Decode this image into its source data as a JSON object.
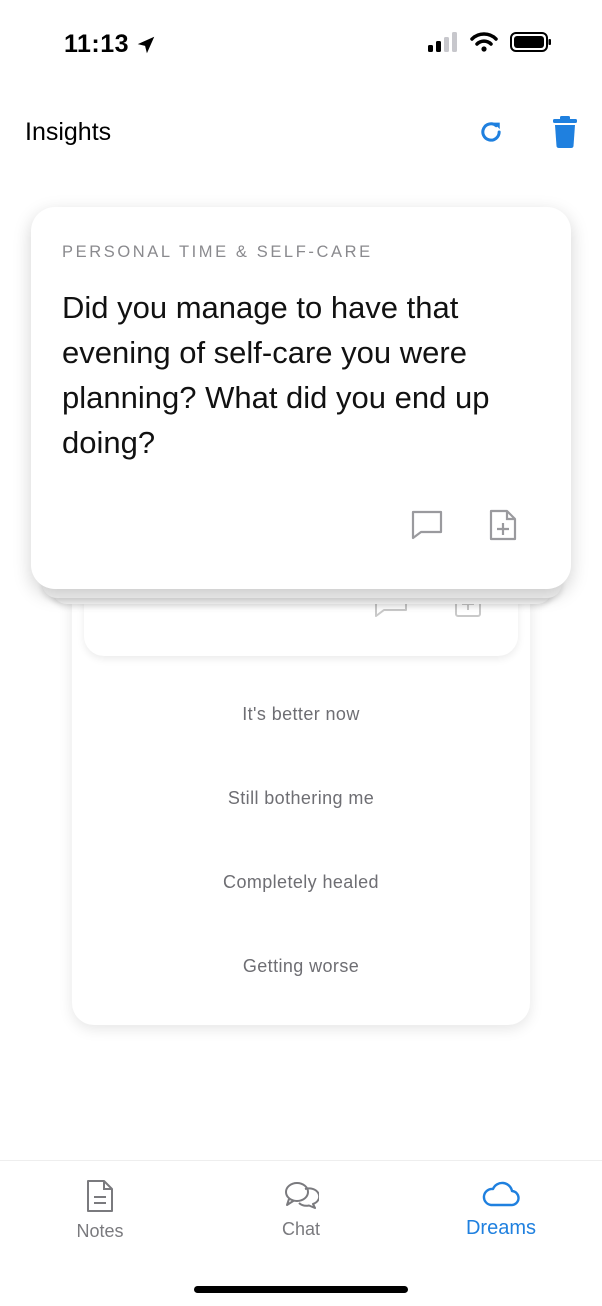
{
  "status_bar": {
    "time": "11:13",
    "icons": [
      "location-arrow-icon",
      "signal-icon",
      "wifi-icon",
      "battery-icon"
    ]
  },
  "header": {
    "title": "Insights",
    "refresh_icon": "refresh-icon",
    "delete_icon": "trash-icon",
    "accent_color": "#1f80df"
  },
  "front_card": {
    "category": "PERSONAL TIME & SELF-CARE",
    "question": "Did you manage to have that evening of self-care you were planning? What did you end up doing?",
    "actions": [
      "comment-icon",
      "add-note-icon"
    ]
  },
  "back_card": {
    "options": [
      "It's better now",
      "Still bothering me",
      "Completely healed",
      "Getting worse"
    ]
  },
  "tabbar": {
    "tabs": [
      {
        "label": "Notes",
        "icon": "note-icon",
        "active": false
      },
      {
        "label": "Chat",
        "icon": "chat-icon",
        "active": false
      },
      {
        "label": "Dreams",
        "icon": "cloud-icon",
        "active": true
      }
    ]
  }
}
